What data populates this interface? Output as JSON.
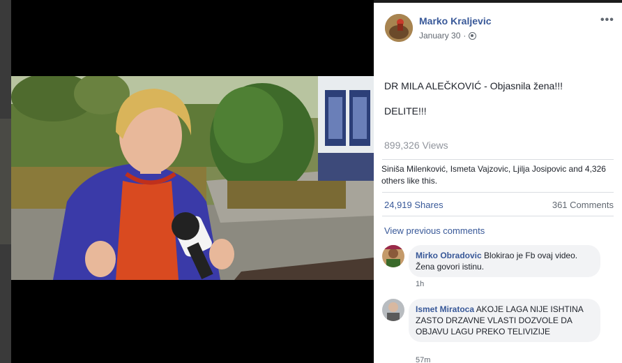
{
  "post": {
    "author": "Marko Kraljevic",
    "date": "January 30",
    "separator": "·",
    "more_label": "•••",
    "text_line1": "DR MILA ALEČKOVIĆ - Objasnila žena!!!",
    "text_line2": "DELITE!!!",
    "views": "899,326 Views",
    "likes_text": "Siniša Milenković, Ismeta Vajzovic, Ljilja Josipovic and 4,326 others like this.",
    "shares": "24,919 Shares",
    "comments_count": "361 Comments",
    "view_previous": "View previous comments"
  },
  "comments": [
    {
      "name": "Mirko Obradovic",
      "text": "Blokirao je Fb ovaj video. Žena govori istinu.",
      "time": "1h"
    },
    {
      "name": "Ismet Miratoca",
      "text": "AKOJE LAGA NIJE ISHTINA ZASTO DRZAVNE VLASTI DOZVOLE DA OBJAVU LAGU PREKO TELIVIZIJE",
      "time": "57m"
    }
  ],
  "colors": {
    "link": "#385898",
    "muted": "#606770",
    "bubble": "#f2f3f5"
  },
  "icons": [
    "globe-icon",
    "more-options-icon"
  ]
}
